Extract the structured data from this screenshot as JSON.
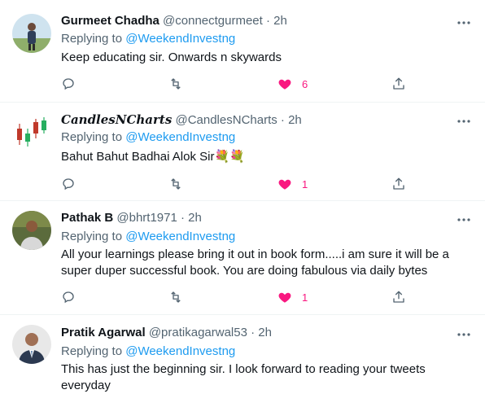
{
  "tweets": [
    {
      "name": "Gurmeet Chadha",
      "handle": "@connectgurmeet",
      "dot": "·",
      "time": "2h",
      "replying_prefix": "Replying to",
      "replying_to": "@WeekendInvestng",
      "text": "Keep educating sir. Onwards n skywards",
      "like_count": "6",
      "avatar_icon": "person-photo-icon"
    },
    {
      "name": "CandlesNCharts",
      "handle": "@CandlesNCharts",
      "dot": "·",
      "time": "2h",
      "replying_prefix": "Replying to",
      "replying_to": "@WeekendInvestng",
      "text": "Bahut Bahut Badhai Alok Sir💐💐",
      "like_count": "1",
      "avatar_icon": "candlestick-logo-icon"
    },
    {
      "name": "Pathak B",
      "handle": "@bhrt1971",
      "dot": "·",
      "time": "2h",
      "replying_prefix": "Replying to",
      "replying_to": "@WeekendInvestng",
      "text": "All your learnings please bring it out in book form.....i am sure it will be a super duper successful book. You are doing fabulous via daily bytes",
      "like_count": "1",
      "avatar_icon": "person-photo-icon"
    },
    {
      "name": "Pratik Agarwal",
      "handle": "@pratikagarwal53",
      "dot": "·",
      "time": "2h",
      "replying_prefix": "Replying to",
      "replying_to": "@WeekendInvestng",
      "text": "This has just the beginning sir. I look forward to reading your tweets everyday",
      "avatar_icon": "person-photo-icon"
    }
  ],
  "colors": {
    "link": "#1d9bf0",
    "like": "#f91880",
    "muted": "#536471",
    "divider": "#eff3f4"
  }
}
